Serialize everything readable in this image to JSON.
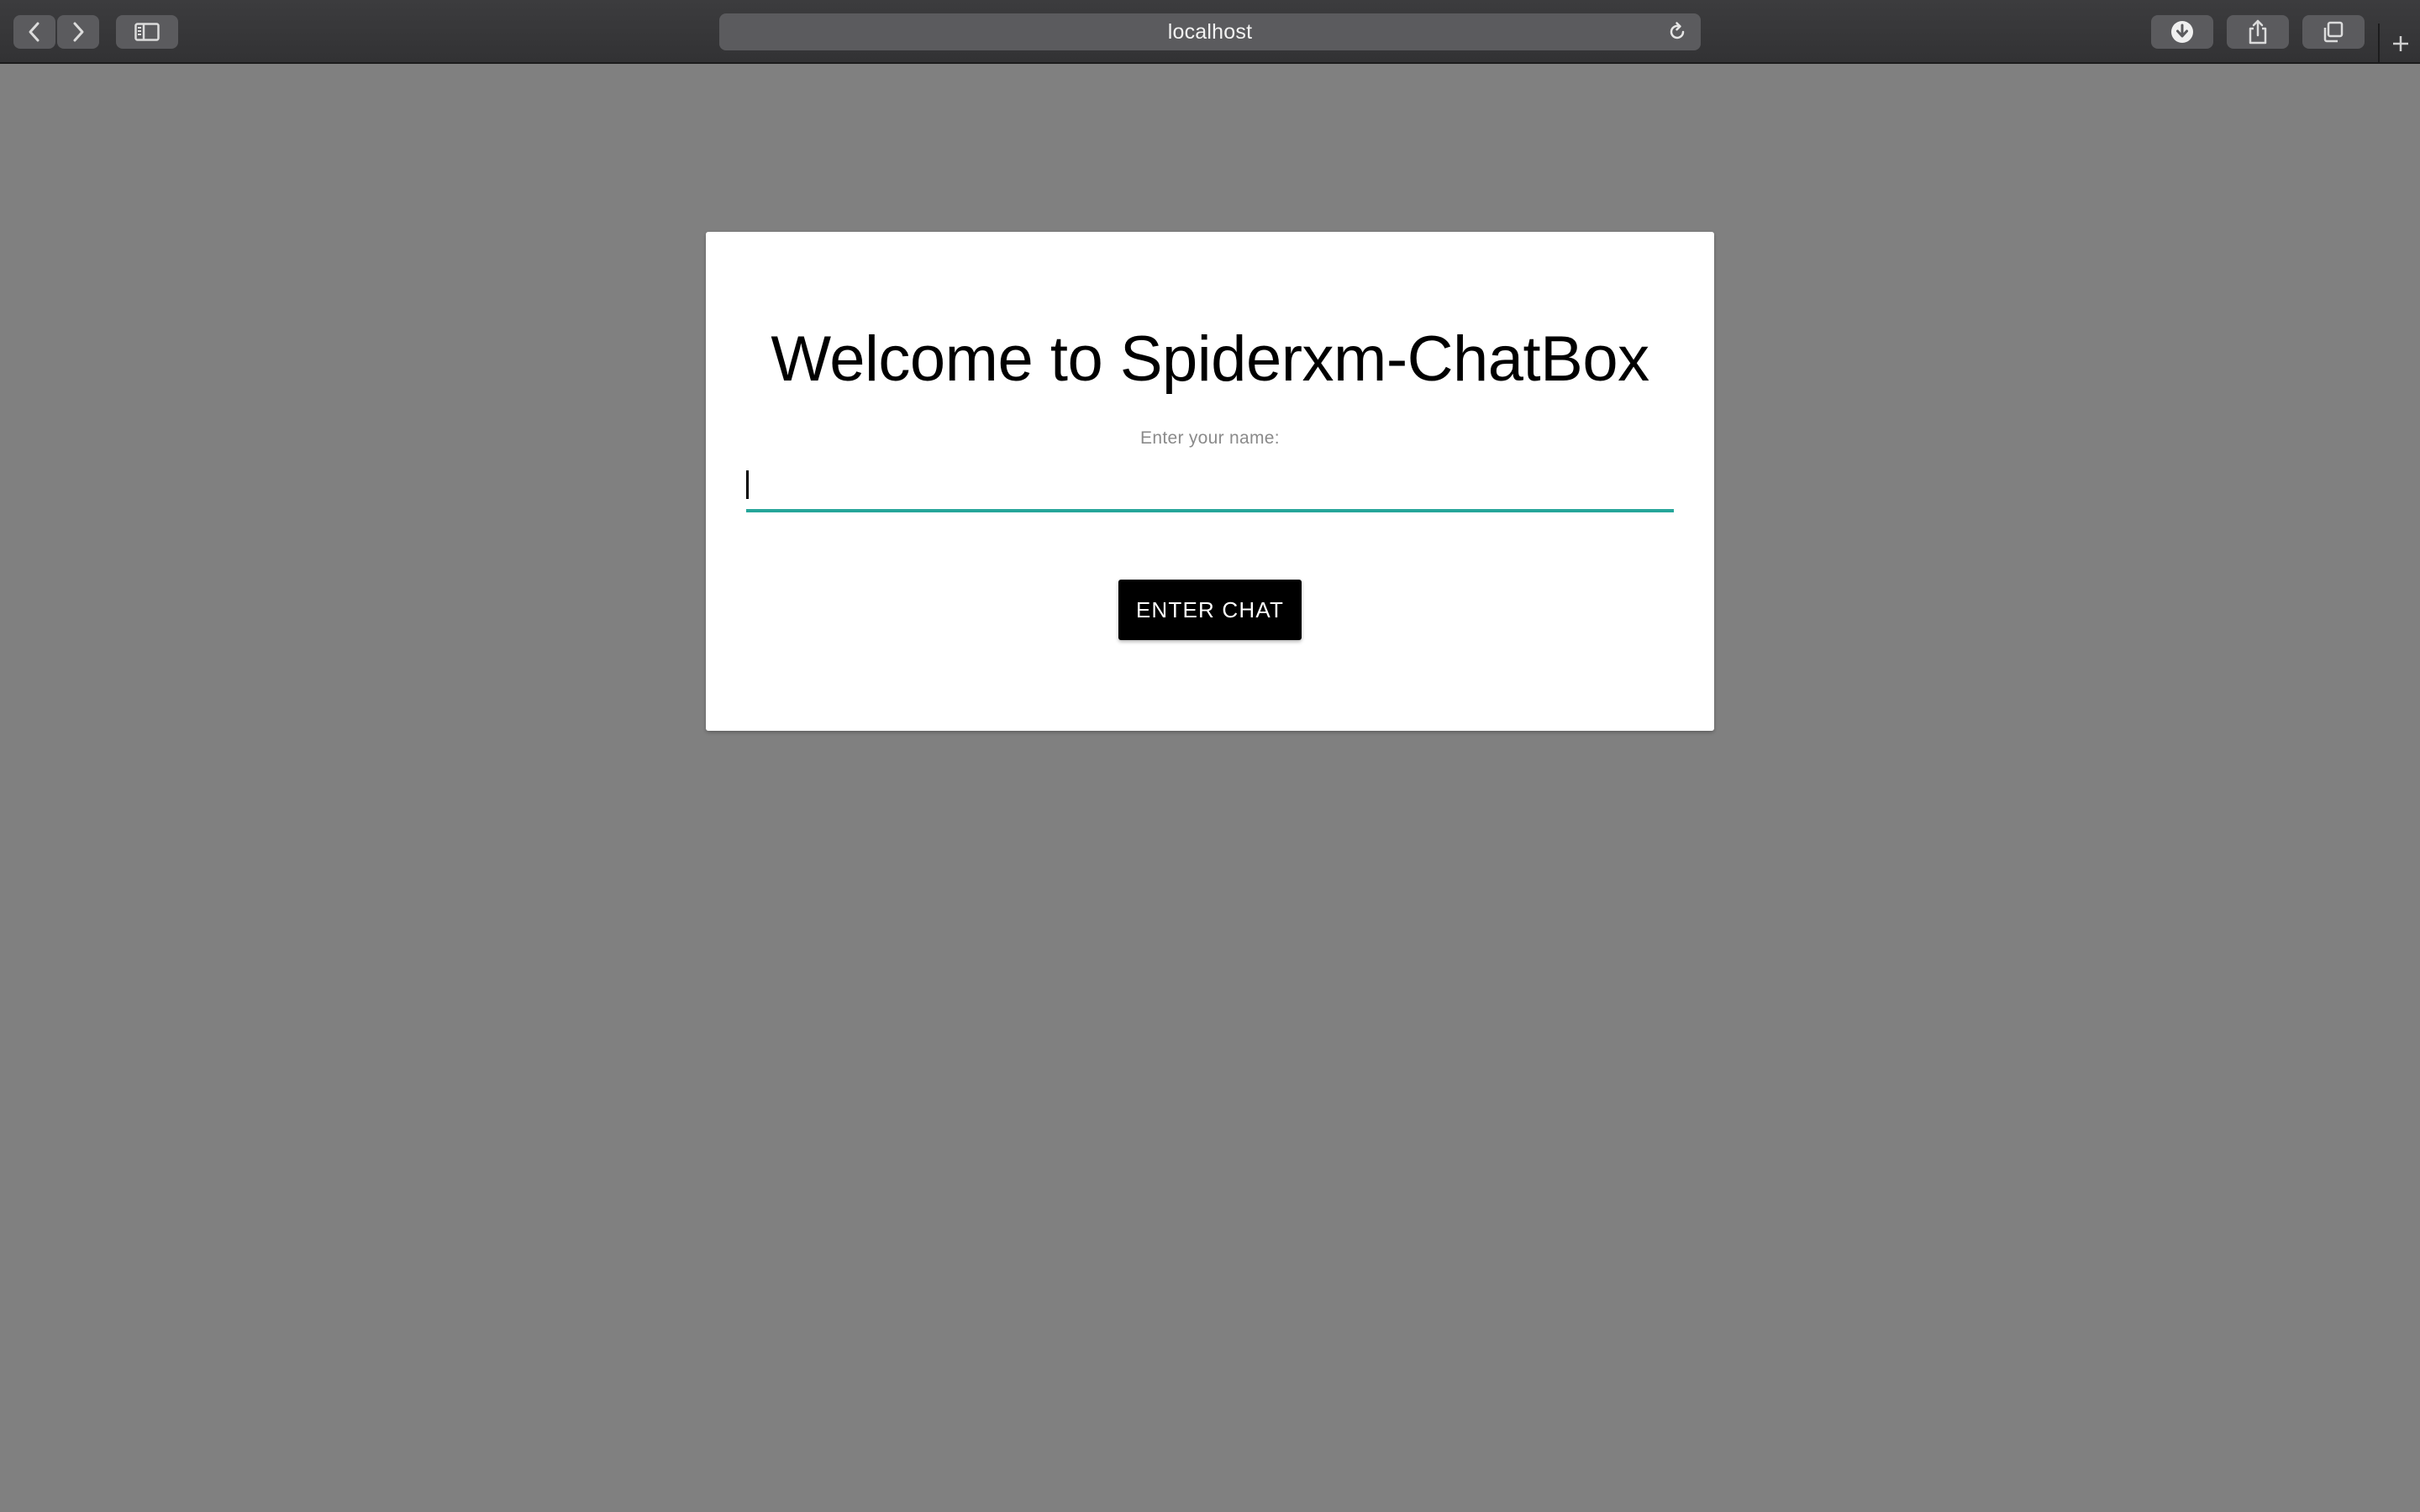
{
  "browser": {
    "address": "localhost",
    "buttons": {
      "back": "chevron-left-icon",
      "forward": "chevron-right-icon",
      "sidebar": "sidebar-icon",
      "reload": "reload-icon",
      "downloads": "download-icon",
      "share": "share-icon",
      "tabs": "tabs-overview-icon",
      "new_tab": "plus-icon"
    }
  },
  "page": {
    "title": "Welcome to Spiderxm-ChatBox",
    "name_label": "Enter your name:",
    "name_input_value": "",
    "submit_label": "ENTER CHAT"
  },
  "colors": {
    "page_background": "#808080",
    "card_background": "#ffffff",
    "input_underline": "#26a69a",
    "button_background": "#000000",
    "button_text": "#ffffff"
  }
}
